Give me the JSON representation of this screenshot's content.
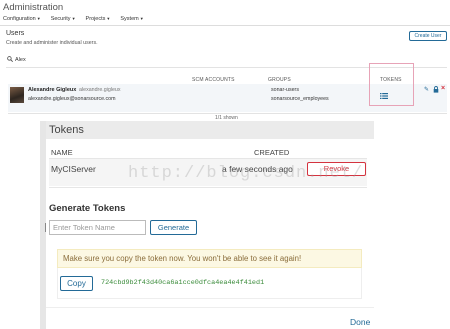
{
  "app": {
    "title": "Administration"
  },
  "nav": {
    "items": [
      {
        "label": "Configuration"
      },
      {
        "label": "Security"
      },
      {
        "label": "Projects"
      },
      {
        "label": "System"
      }
    ]
  },
  "users": {
    "title": "Users",
    "description": "Create and administer individual users.",
    "create_button": "Create User",
    "search_value": "Alex",
    "columns": {
      "scm": "SCM ACCOUNTS",
      "groups": "GROUPS",
      "tokens": "TOKENS"
    },
    "rows": [
      {
        "name": "Alexandre Gigleux",
        "login": "alexandre.gigleux",
        "email": "alexandre.gigleux@sonarsource.com",
        "groups": [
          "sonar-users",
          "sonarsource_employees"
        ]
      }
    ],
    "shown": "1/1 shown"
  },
  "modal": {
    "title": "Tokens",
    "columns": {
      "name": "NAME",
      "created": "CREATED"
    },
    "tokens": [
      {
        "name": "MyCIServer",
        "created": "a few seconds ago",
        "revoke_label": "Revoke"
      }
    ],
    "generate": {
      "title": "Generate Tokens",
      "placeholder": "Enter Token Name",
      "button": "Generate"
    },
    "warning": "Make sure you copy the token now. You won't be able to see it again!",
    "copy_button": "Copy",
    "token_value": "724cbd9b2f43d40ca6a1cce0dfca4ea4e4f41ed1",
    "done": "Done"
  },
  "watermark": "http://blog.csdn.net/",
  "colors": {
    "accent": "#236a97",
    "danger": "#d4333f",
    "warning_bg": "#fcf8e3",
    "token_green": "#3a8b3a"
  },
  "icons": {
    "search": "search-icon",
    "tokens": "list-icon",
    "edit": "pencil-icon",
    "lock": "lock-icon",
    "delete": "close-icon"
  }
}
